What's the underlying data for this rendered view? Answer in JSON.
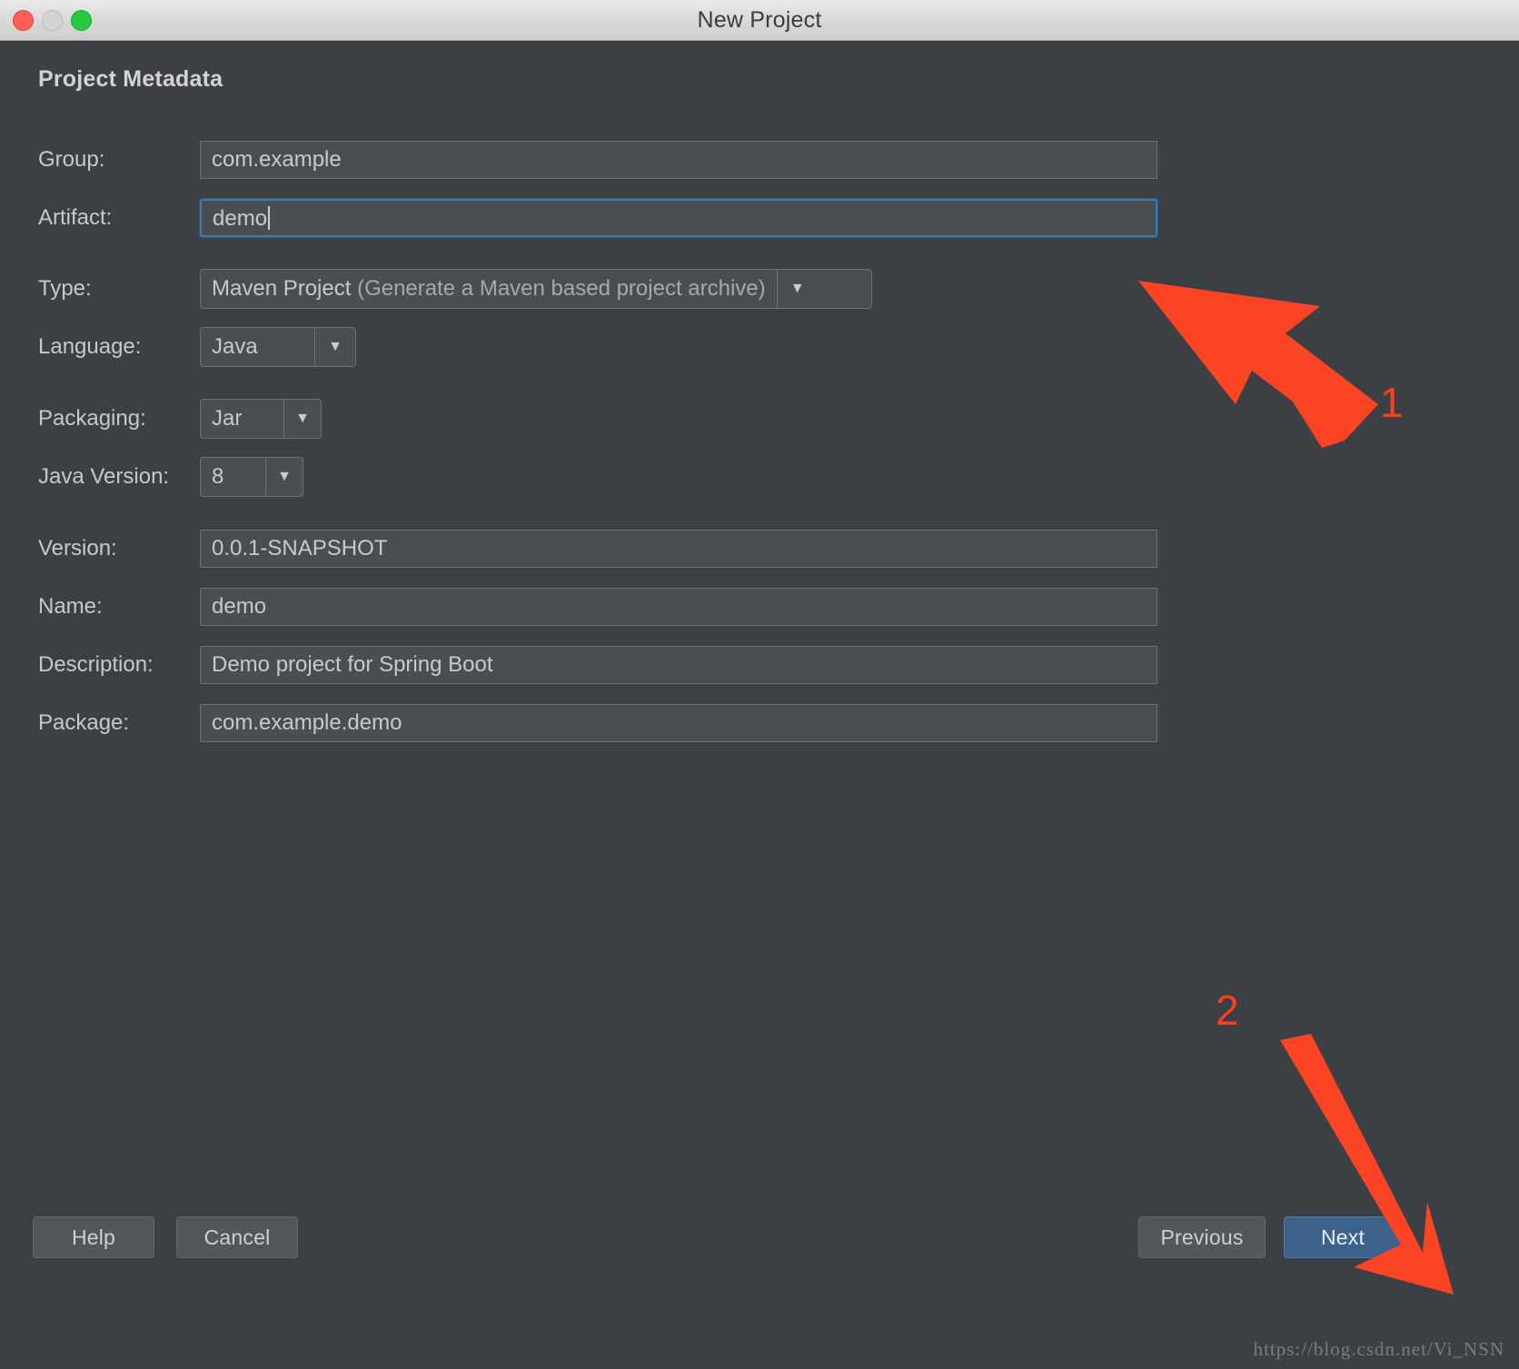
{
  "window": {
    "title": "New Project",
    "controls": [
      "close-button",
      "minimize-button",
      "maximize-button"
    ]
  },
  "section": {
    "title": "Project Metadata"
  },
  "fields": [
    {
      "label": "Group:",
      "value": "com.example",
      "kind": "text",
      "focused": false
    },
    {
      "label": "Artifact:",
      "value": "demo",
      "kind": "text",
      "focused": true
    },
    {
      "label": "Type:",
      "value": "Maven Project",
      "value_suffix": "(Generate a Maven based project archive)",
      "kind": "combo"
    },
    {
      "label": "Language:",
      "value": "Java",
      "kind": "combo"
    },
    {
      "label": "Packaging:",
      "value": "Jar",
      "kind": "combo"
    },
    {
      "label": "Java Version:",
      "value": "8",
      "kind": "combo"
    },
    {
      "label": "Version:",
      "value": "0.0.1-SNAPSHOT",
      "kind": "text",
      "focused": false
    },
    {
      "label": "Name:",
      "value": "demo",
      "kind": "text",
      "focused": false
    },
    {
      "label": "Description:",
      "value": "Demo project for Spring Boot",
      "kind": "text",
      "focused": false
    },
    {
      "label": "Package:",
      "value": "com.example.demo",
      "kind": "text",
      "focused": false
    }
  ],
  "buttons": {
    "help": "Help",
    "cancel": "Cancel",
    "previous": "Previous",
    "next": "Next"
  },
  "annotations": {
    "one": "1",
    "two": "2",
    "color": "#f8401c"
  },
  "watermark": "https://blog.csdn.net/Vi_NSN",
  "colors": {
    "dialog_bg": "#3c4044",
    "field_bg": "#4a4e52",
    "field_border": "#6d7176",
    "focus_border": "#4078a8",
    "primary_button": "#3c628c",
    "text": "#c9c9c9"
  }
}
